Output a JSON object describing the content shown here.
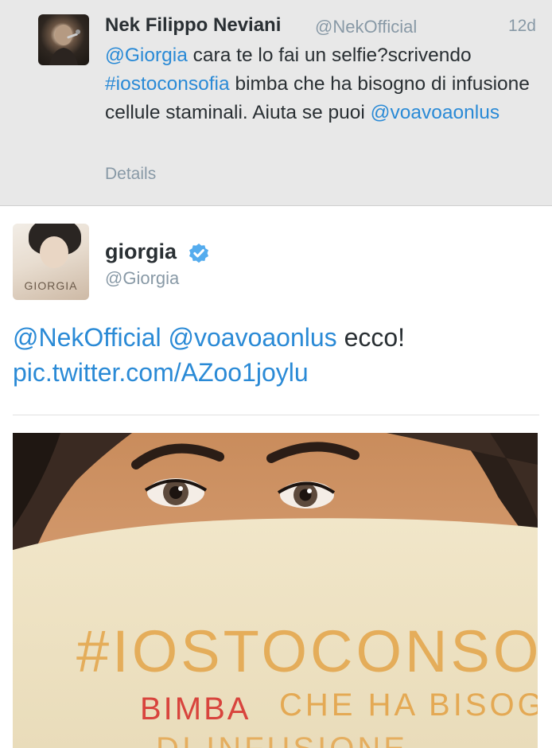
{
  "parent_tweet": {
    "author_name": "Nek Filippo Neviani",
    "author_handle": "@NekOfficial",
    "time": "12d",
    "text_parts": [
      {
        "text": "@Giorgia",
        "link": true
      },
      {
        "text": " cara te lo fai un selfie?scrivendo ",
        "link": false
      },
      {
        "text": "#iostoconsofia",
        "link": true
      },
      {
        "text": " bimba che ha bisogno di infusione cellule staminali. Aiuta se puoi ",
        "link": false
      },
      {
        "text": "@voavoaonlus",
        "link": true
      }
    ],
    "details_label": "Details"
  },
  "main_tweet": {
    "author_name": "giorgia",
    "author_handle": "@Giorgia",
    "verified_icon": "verified-badge-icon",
    "avatar_text": "GIORGIA",
    "text_parts": [
      {
        "text": "@NekOfficial",
        "link": true
      },
      {
        "text": " ",
        "link": false
      },
      {
        "text": "@voavoaonlus",
        "link": true
      },
      {
        "text": " ecco! ",
        "link": false
      },
      {
        "text": "pic.twitter.com/AZoo1joylu",
        "link": true
      }
    ],
    "photo": {
      "sign_line1": "#IOSTOCONSOFIA",
      "sign_line2_a": "BIMBA",
      "sign_line2_b": "CHE HA BISOGNO",
      "sign_line3": "DI INFUSIONE"
    }
  },
  "colors": {
    "link": "#2a8ad6",
    "parent_bg": "#e8e8e8",
    "text": "#292f33",
    "muted": "#8899a6",
    "verified": "#55acee"
  }
}
